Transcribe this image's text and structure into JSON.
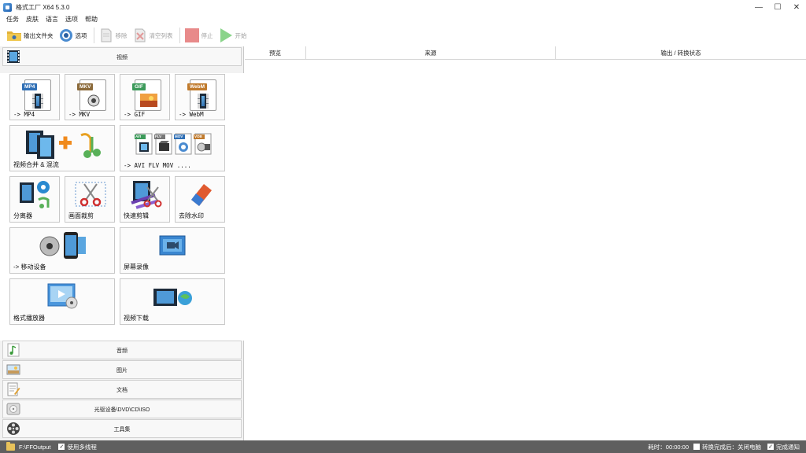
{
  "window": {
    "title": "格式工厂 X64 5.3.0",
    "min": "—",
    "max": "☐",
    "close": "✕"
  },
  "menu": [
    "任务",
    "皮肤",
    "语言",
    "选项",
    "帮助"
  ],
  "toolbar": {
    "output_folder": "输出文件夹",
    "options": "选项",
    "remove": "移除",
    "clear_list": "清空列表",
    "stop": "停止",
    "start": "开始"
  },
  "categories": {
    "video": "视频",
    "audio": "音频",
    "image": "图片",
    "document": "文档",
    "disc": "光驱设备\\DVD\\CD\\ISO",
    "toolbox": "工具集"
  },
  "tiles": {
    "mp4": {
      "label": "-> MP4",
      "badge": "MP4"
    },
    "mkv": {
      "label": "-> MKV",
      "badge": "MKV"
    },
    "gif": {
      "label": "-> GIF",
      "badge": "GIF"
    },
    "webm": {
      "label": "-> WebM",
      "badge": "WebM"
    },
    "merge": "视频合并 & 混流",
    "multi": {
      "label": "-> AVI FLV MOV ....",
      "badges": [
        "AVI",
        "FLV",
        "MOV",
        "VOB"
      ]
    },
    "splitter": "分离器",
    "crop": "画面裁剪",
    "quick_clip": "快速剪辑",
    "watermark": "去除水印",
    "mobile": "-> 移动设备",
    "screen_record": "屏幕录像",
    "player": "格式播放器",
    "download": "视频下载"
  },
  "grid": {
    "preview": "预览",
    "source": "来源",
    "output_status": "输出 / 转换状态"
  },
  "status": {
    "path": "F:\\FFOutput",
    "multithread": "使用多线程",
    "multithread_checked": true,
    "elapsed": "耗时：00:00:00",
    "after_convert": "转换完成后：关闭电脑",
    "after_convert_checked": false,
    "notify": "完成通知",
    "notify_checked": true
  },
  "colors": {
    "mp4_badge": "#2f6fb5",
    "mkv_badge": "#8b6a3a",
    "gif_badge": "#3c9a5a",
    "webm_badge": "#c07a2c",
    "status_bar": "#5f5f5f",
    "stop": "#e88a8a",
    "start": "#8ad48a"
  }
}
